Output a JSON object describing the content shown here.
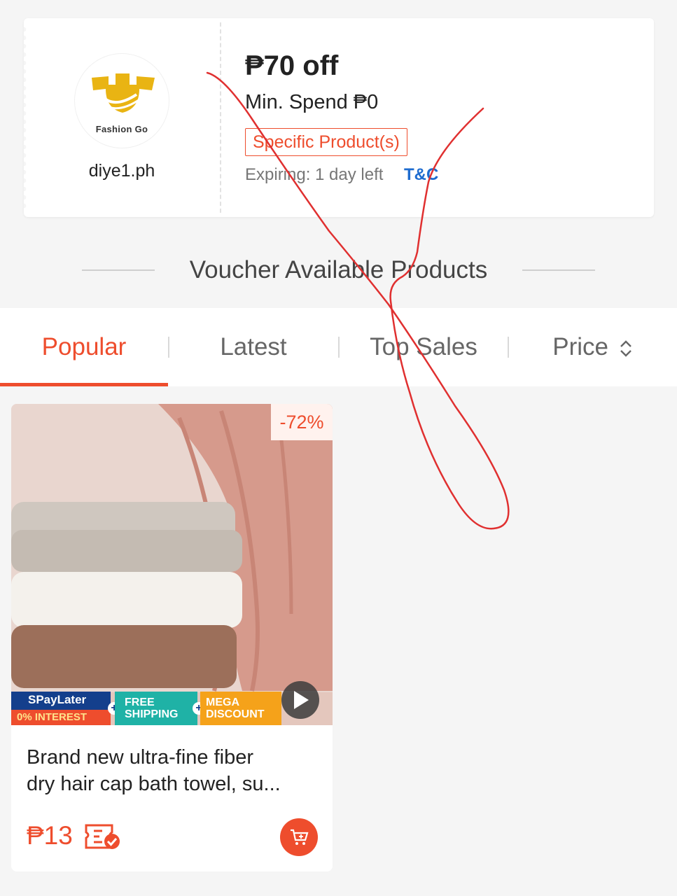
{
  "voucher": {
    "shop_logo_text": "Fashion Go",
    "shop_name": "diye1.ph",
    "amount": "₱70 off",
    "min_spend": "Min. Spend ₱0",
    "tag": "Specific Product(s)",
    "expiry": "Expiring: 1 day left",
    "tc_label": "T&C"
  },
  "section_title": "Voucher Available Products",
  "tabs": [
    {
      "label": "Popular",
      "active": true
    },
    {
      "label": "Latest"
    },
    {
      "label": "Top Sales"
    },
    {
      "label": "Price"
    }
  ],
  "products": [
    {
      "discount": "-72%",
      "badge_spaylater": "SPayLater",
      "badge_interest": "0% INTEREST",
      "badge_free_1": "FREE",
      "badge_free_2": "SHIPPING",
      "badge_mega_1": "MEGA",
      "badge_mega_2": "DISCOUNT",
      "title_line1": "Brand new ultra-fine fiber",
      "title_line2": "dry hair cap bath towel, su...",
      "price": "₱13"
    }
  ],
  "colors": {
    "accent": "#ee4d2d",
    "link": "#1e6ccf",
    "background": "#f5f5f5",
    "annotation_stroke": "#e03030"
  }
}
